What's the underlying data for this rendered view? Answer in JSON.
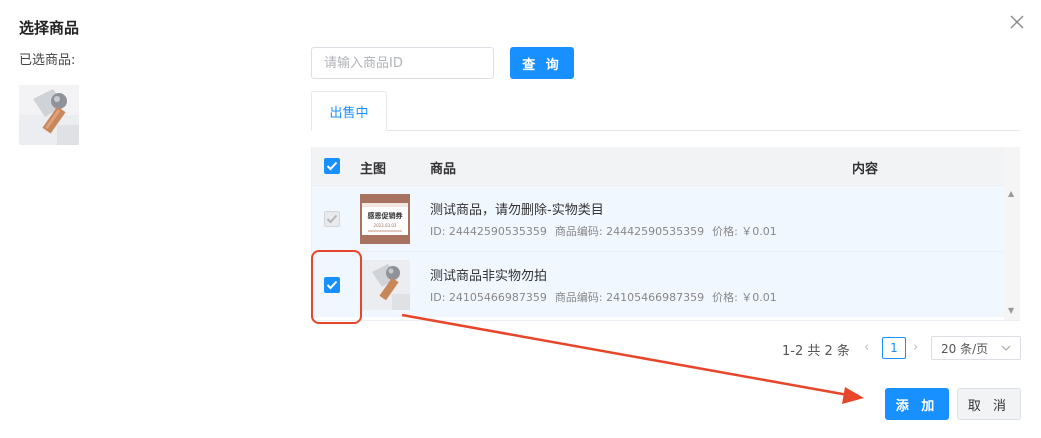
{
  "dialog": {
    "title": "选择商品",
    "selected_label": "已选商品:",
    "close_icon": "close-icon"
  },
  "search": {
    "placeholder": "请输入商品ID",
    "value": "",
    "button_label": "查 询"
  },
  "tabs": [
    {
      "label": "出售中",
      "active": true
    }
  ],
  "table": {
    "columns": [
      "主图",
      "商品",
      "内容"
    ],
    "header_checked": true,
    "rows": [
      {
        "name": "测试商品，请勿删除-实物类目",
        "id_text": "ID: 24442590535359",
        "code_text": "商品编码: 24442590535359",
        "price_text": "价格: ￥0.01",
        "checkbox_state": "checked-disabled",
        "thumb_banner": "感恩促销券",
        "thumb_caption": "2023.03.03"
      },
      {
        "name": "测试商品非实物勿拍",
        "id_text": "ID: 24105466987359",
        "code_text": "商品编码: 24105466987359",
        "price_text": "价格: ￥0.01",
        "checkbox_state": "checked"
      }
    ]
  },
  "pagination": {
    "total_text": "1-2 共 2 条",
    "current_page": "1",
    "page_size": "20 条/页"
  },
  "footer": {
    "add_label": "添 加",
    "cancel_label": "取 消"
  },
  "colors": {
    "accent": "#1890ff",
    "annotation": "#e8462a"
  }
}
